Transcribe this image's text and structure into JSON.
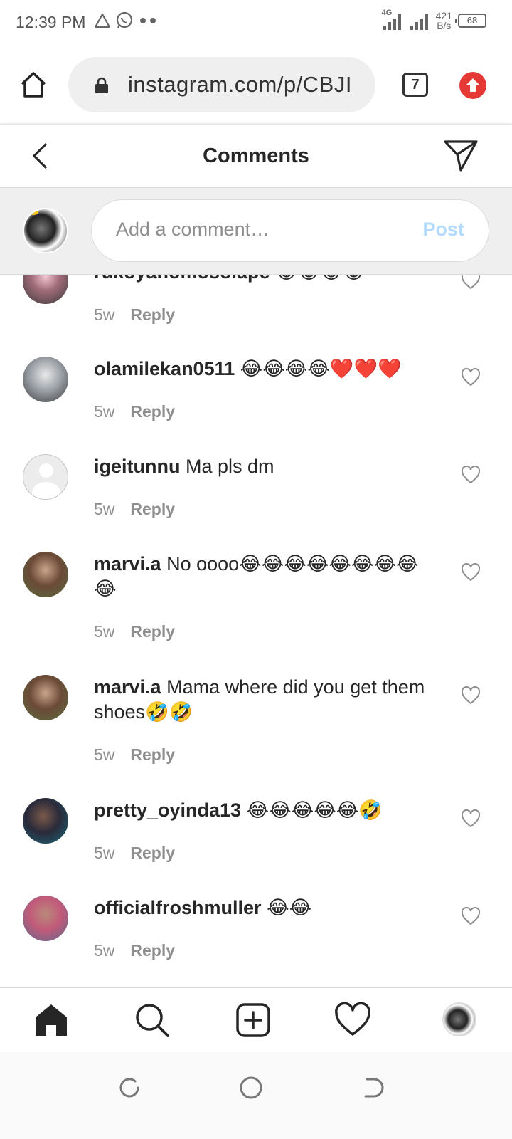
{
  "status_bar": {
    "time": "12:39 PM",
    "network_type": "4G",
    "net_speed_value": "421",
    "net_speed_unit": "B/s",
    "battery": "68"
  },
  "browser": {
    "url": "instagram.com/p/CBJI",
    "tab_count": "7",
    "icons": {
      "home": "home-icon",
      "lock": "lock-icon",
      "update": "update-arrow-icon"
    }
  },
  "header": {
    "title": "Comments"
  },
  "composer": {
    "placeholder": "Add a comment…",
    "post_label": "Post"
  },
  "comments": [
    {
      "username": "rukoyahomosolape",
      "text": "😂😂😂😂",
      "age": "5w",
      "reply_label": "Reply"
    },
    {
      "username": "olamilekan0511",
      "text": "😂😂😂😂❤️❤️❤️",
      "age": "5w",
      "reply_label": "Reply"
    },
    {
      "username": "igeitunnu",
      "text": "Ma pls dm",
      "age": "5w",
      "reply_label": "Reply"
    },
    {
      "username": "marvi.a",
      "text": "No oooo😂😂😂😂😂😂😂😂😂",
      "age": "5w",
      "reply_label": "Reply"
    },
    {
      "username": "marvi.a",
      "text": "Mama where did you get them shoes🤣🤣",
      "age": "5w",
      "reply_label": "Reply"
    },
    {
      "username": "pretty_oyinda13",
      "text": "😂😂😂😂😂🤣",
      "age": "5w",
      "reply_label": "Reply"
    },
    {
      "username": "officialfroshmuller",
      "text": "😂😂",
      "age": "5w",
      "reply_label": "Reply"
    }
  ],
  "colors": {
    "text": "#262626",
    "secondary": "#8e8e8e",
    "post_disabled": "#b3dbff",
    "update_red": "#e53935"
  }
}
